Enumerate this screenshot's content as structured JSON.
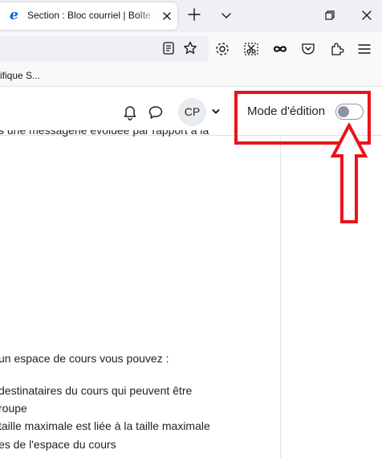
{
  "browser": {
    "tab_title": "Section : Bloc courriel | Boîte à",
    "favicon": "e",
    "new_tab_icon": "plus-icon",
    "bookmark_item": "ifique S..."
  },
  "header": {
    "avatar_initials": "CP",
    "edit_mode_label": "Mode d'édition",
    "edit_mode_on": false
  },
  "content": {
    "cut_text": "s une messagerie évoluée par rapport à la",
    "intro": "un espace de cours vous pouvez :",
    "lines": [
      "destinataires du cours qui peuvent être",
      "roupe",
      "taille maximale est liée à la taille maximale",
      "es de l'espace du cours"
    ]
  },
  "colors": {
    "annotation_red": "#e8141c",
    "toggle_gray": "#8f959e",
    "tab_strip": "#f0f0f4"
  }
}
